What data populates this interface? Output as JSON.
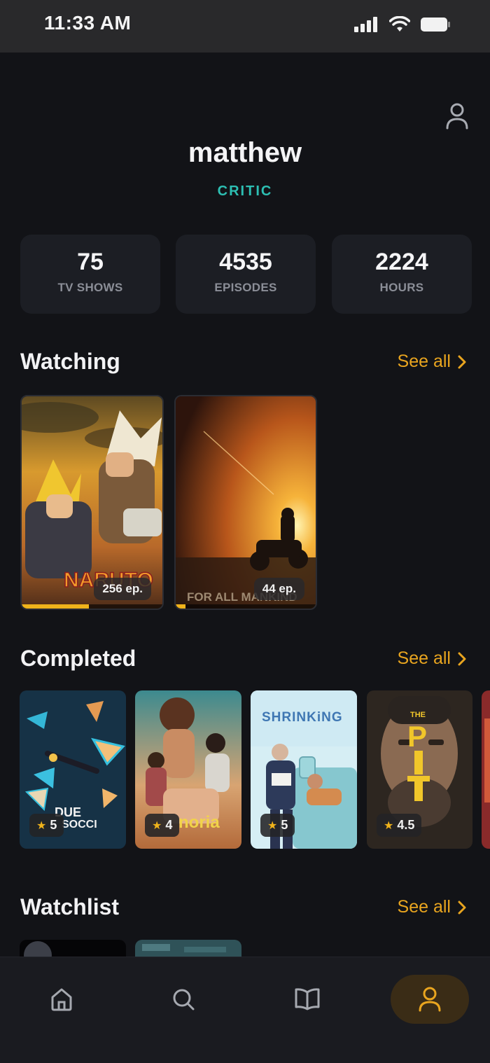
{
  "status_bar": {
    "time": "11:33 AM"
  },
  "profile": {
    "username": "matthew",
    "role": "CRITIC"
  },
  "stats": [
    {
      "value": "75",
      "label": "TV SHOWS"
    },
    {
      "value": "4535",
      "label": "EPISODES"
    },
    {
      "value": "2224",
      "label": "HOURS"
    }
  ],
  "sections": {
    "watching": {
      "title": "Watching",
      "see_all": "See all"
    },
    "completed": {
      "title": "Completed",
      "see_all": "See all"
    },
    "watchlist": {
      "title": "Watchlist",
      "see_all": "See all"
    }
  },
  "watching": [
    {
      "title_art": "NARUTO",
      "episodes": "256 ep.",
      "progress": 0.48
    },
    {
      "title_art": "FOR ALL MANKIND",
      "episodes": "44 ep.",
      "progress": 0.07
    }
  ],
  "completed": [
    {
      "title_art": "DUE SOCCI",
      "rating": "5"
    },
    {
      "title_art": "noria",
      "rating": "4"
    },
    {
      "title_art": "SHRINKING",
      "rating": "5"
    },
    {
      "title_art": "THE PITT",
      "rating": "4.5"
    }
  ],
  "nav": {
    "items": [
      "home",
      "search",
      "library",
      "profile"
    ],
    "active": "profile"
  },
  "colors": {
    "background": "#121317",
    "accent": "#e9a51f",
    "role": "#2dbfb3",
    "card": "#1c1e24"
  }
}
